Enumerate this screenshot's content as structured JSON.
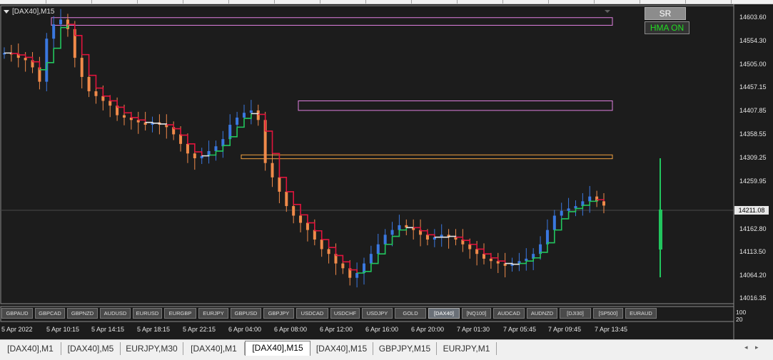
{
  "chart": {
    "title": "[DAX40],M15",
    "current_price": "14211.08",
    "price_axis": [
      "14603.60",
      "14554.30",
      "14505.00",
      "14457.15",
      "14407.85",
      "14358.55",
      "14309.25",
      "14259.95",
      "14211.08",
      "14162.80",
      "14113.50",
      "14064.20",
      "14016.35"
    ],
    "time_axis": [
      "5 Apr 2022",
      "5 Apr 10:15",
      "5 Apr 14:15",
      "5 Apr 18:15",
      "5 Apr 22:15",
      "6 Apr 04:00",
      "6 Apr 08:00",
      "6 Apr 12:00",
      "6 Apr 16:00",
      "6 Apr 20:00",
      "7 Apr 01:30",
      "7 Apr 05:45",
      "7 Apr 09:45",
      "7 Apr 13:45"
    ],
    "subwindow_levels": [
      "100",
      "20"
    ],
    "colors": {
      "background": "#1c1c1c",
      "candle_up": "#3a78e0",
      "candle_down": "#f08a4a",
      "hma_red": "#e0143c",
      "hma_green": "#22c55e",
      "hma_white": "#e6e6e6",
      "zone_resistance": "#e080e0",
      "zone_support": "#f0a040"
    }
  },
  "buttons": {
    "sr": "SR",
    "hma": "HMA ON"
  },
  "symbols": [
    "GBPAUD",
    "GBPCAD",
    "GBPNZD",
    "AUDUSD",
    "EURUSD",
    "EURGBP",
    "EURJPY",
    "GBPUSD",
    "GBPJPY",
    "USDCAD",
    "USDCHF",
    "USDJPY",
    "GOLD",
    "[DAX40]",
    "[NQ100]",
    "AUDCAD",
    "AUDNZD",
    "[DJI30]",
    "[SP500]",
    "EURAUD"
  ],
  "active_symbol": "[DAX40]",
  "tabs": [
    "[DAX40],M1",
    "[DAX40],M5",
    "EURJPY,M30",
    "[DAX40],M1",
    "[DAX40],M15",
    "[DAX40],M15",
    "GBPJPY,M15",
    "EURJPY,M1"
  ],
  "active_tab": "[DAX40],M15",
  "chart_data": {
    "type": "candlestick",
    "instrument": "[DAX40]",
    "timeframe": "M15",
    "ylim": [
      14016.35,
      14603.6
    ],
    "x": [
      "5 Apr 2022",
      "5 Apr 10:15",
      "5 Apr 14:15",
      "5 Apr 18:15",
      "5 Apr 22:15",
      "6 Apr 04:00",
      "6 Apr 08:00",
      "6 Apr 12:00",
      "6 Apr 16:00",
      "6 Apr 20:00",
      "7 Apr 01:30",
      "7 Apr 05:45",
      "7 Apr 09:45",
      "7 Apr 13:45"
    ],
    "series": [
      {
        "values": [
          14530,
          14528,
          14520,
          14515,
          14500,
          14470,
          14560,
          14590,
          14600,
          14580,
          14520,
          14480,
          14450,
          14440,
          14430,
          14420,
          14400,
          14395,
          14390,
          14385,
          14380,
          14385,
          14380,
          14375,
          14360,
          14340,
          14320,
          14310,
          14315,
          14325,
          14335,
          14350,
          14380,
          14395,
          14405,
          14410,
          14390,
          14300,
          14270,
          14240,
          14210,
          14190,
          14175,
          14160,
          14140,
          14120,
          14110,
          14090,
          14080,
          14060,
          14070,
          14090,
          14110,
          14130,
          14150,
          14160,
          14170,
          14165,
          14160,
          14150,
          14140,
          14145,
          14150,
          14145,
          14140,
          14130,
          14120,
          14110,
          14100,
          14095,
          14090,
          14085,
          14090,
          14095,
          14100,
          14110,
          14130,
          14160,
          14190,
          14200,
          14205,
          14210,
          14220,
          14230,
          14220,
          14211
        ]
      }
    ],
    "zones": [
      {
        "type": "resistance",
        "low": 14588,
        "high": 14604
      },
      {
        "type": "resistance",
        "low": 14410,
        "high": 14430
      },
      {
        "type": "support",
        "low": 14309,
        "high": 14317
      }
    ]
  }
}
